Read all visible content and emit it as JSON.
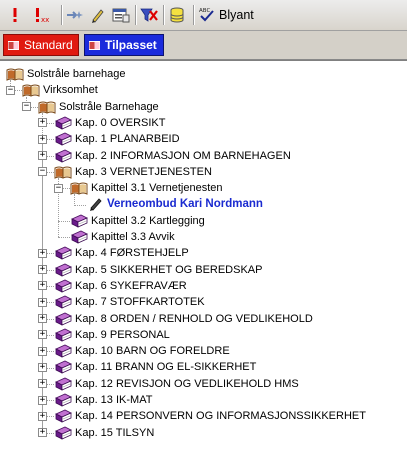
{
  "toolbar": {
    "items": [
      {
        "name": "priority-high-icon"
      },
      {
        "name": "priority-xx-icon"
      },
      {
        "name": "arrow-star-icon"
      },
      {
        "name": "pencil-icon"
      },
      {
        "name": "properties-icon"
      },
      {
        "name": "filter-delete-icon"
      },
      {
        "name": "database-icon"
      },
      {
        "name": "spellcheck-icon"
      }
    ],
    "label": "Blyant"
  },
  "tabs": [
    {
      "label": "Standard",
      "color": "#e01a10"
    },
    {
      "label": "Tilpasset",
      "color": "#1a2adc"
    }
  ],
  "tree": [
    {
      "label": "Solstråle barnehage",
      "level": 0,
      "expander": "none",
      "icon": "open-book"
    },
    {
      "label": "Virksomhet",
      "level": 1,
      "expander": "minus",
      "icon": "open-book"
    },
    {
      "label": "Solstråle Barnehage",
      "level": 2,
      "expander": "minus",
      "icon": "open-book"
    },
    {
      "label": "Kap. 0  OVERSIKT",
      "level": 3,
      "expander": "plus",
      "icon": "closed-book"
    },
    {
      "label": "Kap. 1   PLANARBEID",
      "level": 3,
      "expander": "plus",
      "icon": "closed-book"
    },
    {
      "label": "Kap. 2   INFORMASJON OM BARNEHAGEN",
      "level": 3,
      "expander": "plus",
      "icon": "closed-book"
    },
    {
      "label": "Kap. 3   VERNETJENESTEN",
      "level": 3,
      "expander": "minus",
      "icon": "open-book"
    },
    {
      "label": "Kapittel 3.1 Vernetjenesten",
      "level": 4,
      "expander": "minus",
      "icon": "open-book"
    },
    {
      "label": "Verneombud Kari Nordmann",
      "level": 5,
      "expander": "none",
      "icon": "pencil",
      "bold": true
    },
    {
      "label": "Kapittel 3.2 Kartlegging",
      "level": 4,
      "expander": "none",
      "icon": "closed-book"
    },
    {
      "label": "Kapittel 3.3 Avvik",
      "level": 4,
      "expander": "none",
      "icon": "closed-book"
    },
    {
      "label": "Kap. 4   FØRSTEHJELP",
      "level": 3,
      "expander": "plus",
      "icon": "closed-book"
    },
    {
      "label": "Kap. 5  SIKKERHET OG BEREDSKAP",
      "level": 3,
      "expander": "plus",
      "icon": "closed-book"
    },
    {
      "label": "Kap. 6   SYKEFRAVÆR",
      "level": 3,
      "expander": "plus",
      "icon": "closed-book"
    },
    {
      "label": "Kap. 7   STOFFKARTOTEK",
      "level": 3,
      "expander": "plus",
      "icon": "closed-book"
    },
    {
      "label": "Kap. 8   ORDEN / RENHOLD OG VEDLIKEHOLD",
      "level": 3,
      "expander": "plus",
      "icon": "closed-book"
    },
    {
      "label": "Kap. 9   PERSONAL",
      "level": 3,
      "expander": "plus",
      "icon": "closed-book"
    },
    {
      "label": "Kap. 10 BARN OG FORELDRE",
      "level": 3,
      "expander": "plus",
      "icon": "closed-book"
    },
    {
      "label": "Kap. 11 BRANN OG EL-SIKKERHET",
      "level": 3,
      "expander": "plus",
      "icon": "closed-book"
    },
    {
      "label": "Kap. 12 REVISJON OG VEDLIKEHOLD HMS",
      "level": 3,
      "expander": "plus",
      "icon": "closed-book"
    },
    {
      "label": "Kap. 13 IK-MAT",
      "level": 3,
      "expander": "plus",
      "icon": "closed-book"
    },
    {
      "label": "Kap. 14  PERSONVERN OG INFORMASJONSSIKKERHET",
      "level": 3,
      "expander": "plus",
      "icon": "closed-book"
    },
    {
      "label": "Kap. 15 TILSYN",
      "level": 3,
      "expander": "plus",
      "icon": "closed-book"
    }
  ]
}
